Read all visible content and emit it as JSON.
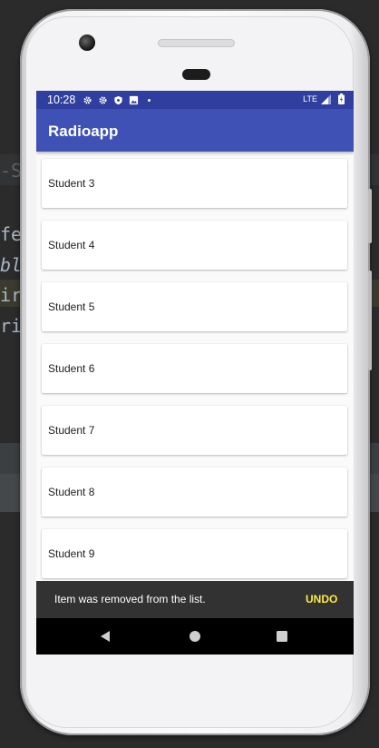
{
  "ide": {
    "fragments": [
      "-St",
      "fe",
      "bl",
      "ir",
      "ri"
    ]
  },
  "status_bar": {
    "time": "10:28",
    "icons": [
      "gear-icon",
      "gear-icon",
      "shield-icon",
      "image-icon",
      "dot-icon"
    ],
    "network": "LTE",
    "right_icons": [
      "signal-icon",
      "battery-icon"
    ]
  },
  "app_bar": {
    "title": "Radioapp"
  },
  "list": {
    "items": [
      {
        "label": "Student 3"
      },
      {
        "label": "Student 4"
      },
      {
        "label": "Student 5"
      },
      {
        "label": "Student 6"
      },
      {
        "label": "Student 7"
      },
      {
        "label": "Student 8"
      },
      {
        "label": "Student 9"
      }
    ]
  },
  "snackbar": {
    "message": "Item was removed from the list.",
    "action": "UNDO"
  },
  "nav_bar": {
    "buttons": [
      "back-icon",
      "home-icon",
      "recents-icon"
    ]
  },
  "colors": {
    "status_bar": "#303f9f",
    "app_bar": "#3f51b5",
    "snackbar": "#323232",
    "snackbar_action": "#ffeb3b",
    "nav_bar": "#000000"
  }
}
